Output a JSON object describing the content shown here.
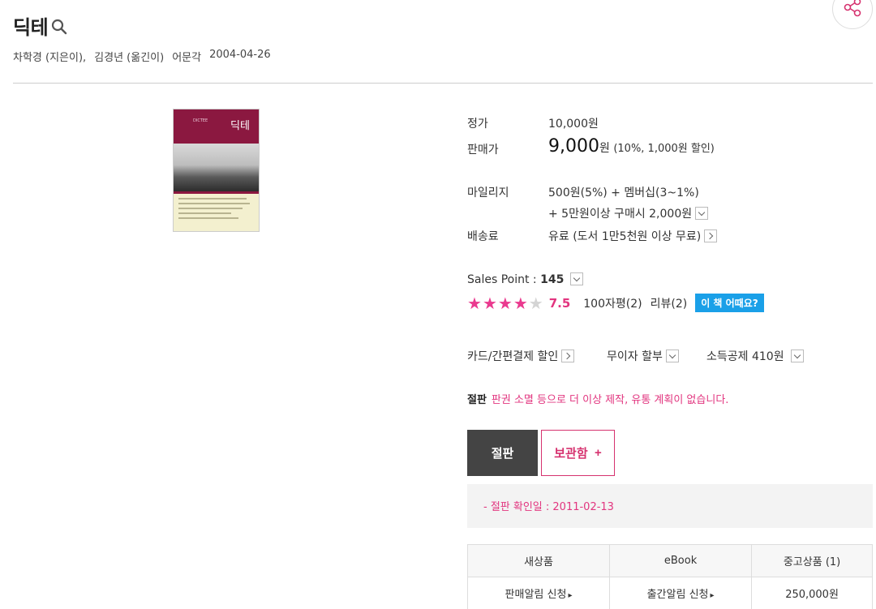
{
  "title": "딕테",
  "byline": {
    "author": "차학경 (지은이),",
    "translator": "김경년 (옮긴이)",
    "publisher": "어문각",
    "date": "2004-04-26"
  },
  "cover": {
    "title": "딕테",
    "small": "DICTEE"
  },
  "price": {
    "list_label": "정가",
    "list_value": "10,000원",
    "sale_label": "판매가",
    "sale_amount": "9,000",
    "sale_unit": "원",
    "sale_discount": "(10%, 1,000원 할인)"
  },
  "mileage": {
    "label": "마일리지",
    "line1": "500원(5%) + 멤버십(3~1%)",
    "line2": "+ 5만원이상 구매시 2,000원"
  },
  "shipping": {
    "label": "배송료",
    "value": "유료 (도서 1만5천원 이상 무료)"
  },
  "sales_point": {
    "label": "Sales Point : ",
    "value": "145"
  },
  "rating": {
    "stars": 4,
    "max_stars": 5,
    "score": "7.5",
    "comments": "100자평(2)",
    "reviews": "리뷰(2)",
    "badge": "이 책 어때요?"
  },
  "benefits": {
    "card": "카드/간편결제 할인",
    "installment": "무이자 할부",
    "tax": "소득공제 410원"
  },
  "outprint": {
    "label": "절판",
    "message": "판권 소멸 등으로 더 이상 제작, 유통 계획이 없습니다."
  },
  "buttons": {
    "outprint": "절판",
    "keep": "보관함",
    "keep_plus": "+"
  },
  "notice": "- 절판 확인일 : 2011-02-13",
  "table": {
    "headers": [
      "새상품",
      "eBook",
      "중고상품 (1)"
    ],
    "row": [
      "판매알림 신청",
      "출간알림 신청",
      "250,000원"
    ]
  },
  "colors": {
    "accent": "#e2357f",
    "badge": "#1aa0e8",
    "dark_button": "#444444"
  }
}
